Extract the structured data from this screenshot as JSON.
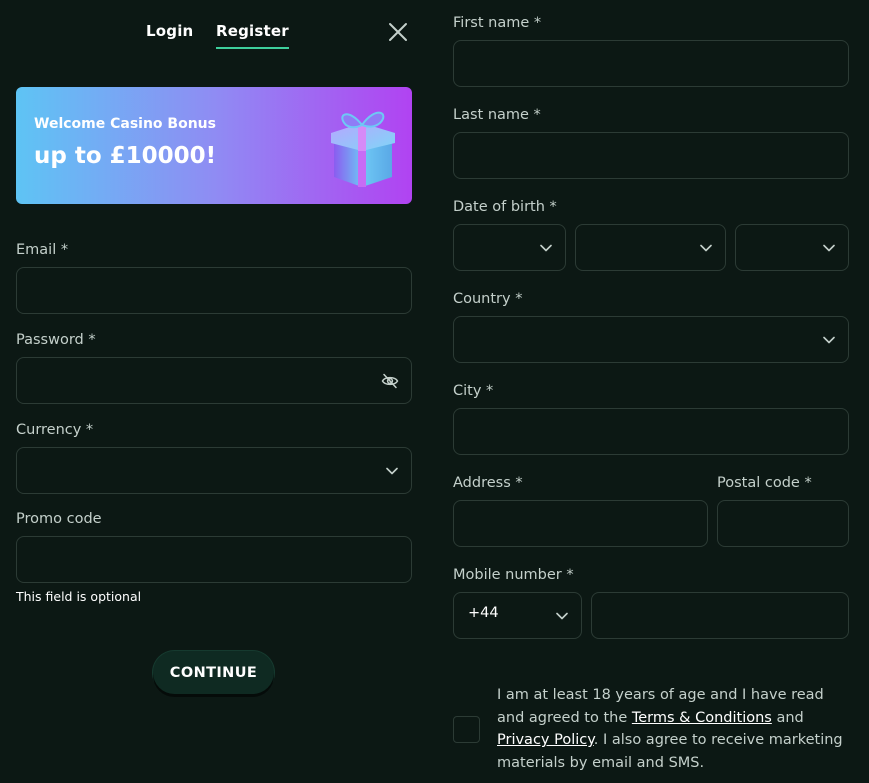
{
  "tabs": {
    "login": "Login",
    "register": "Register"
  },
  "banner": {
    "subtitle": "Welcome Casino Bonus",
    "headline": "up to £10000!"
  },
  "left_form": {
    "email_label": "Email *",
    "password_label": "Password *",
    "currency_label": "Currency *",
    "promo_label": "Promo code",
    "promo_hint": "This field is optional",
    "continue_label": "CONTINUE"
  },
  "right_form": {
    "first_name_label": "First name *",
    "last_name_label": "Last name *",
    "dob_label": "Date of birth *",
    "country_label": "Country *",
    "city_label": "City *",
    "address_label": "Address *",
    "postal_label": "Postal code *",
    "mobile_label": "Mobile number *",
    "phone_code": "+44"
  },
  "consent": {
    "part1": "I am at least 18 years of age and I have read and agreed to the ",
    "terms_link": "Terms & Conditions",
    "part2": " and ",
    "privacy_link": "Privacy Policy",
    "part3": ". I also agree to receive marketing materials by email and SMS."
  },
  "icons": {
    "close": "close-icon",
    "eye": "eye-off-icon",
    "chevron": "chevron-down-icon",
    "gift": "gift-icon"
  },
  "colors": {
    "background": "#0c1814",
    "accent": "#3ecf9c",
    "field_border": "#2c3b35",
    "banner_start": "#5ec4f4",
    "banner_end": "#b143f2"
  }
}
